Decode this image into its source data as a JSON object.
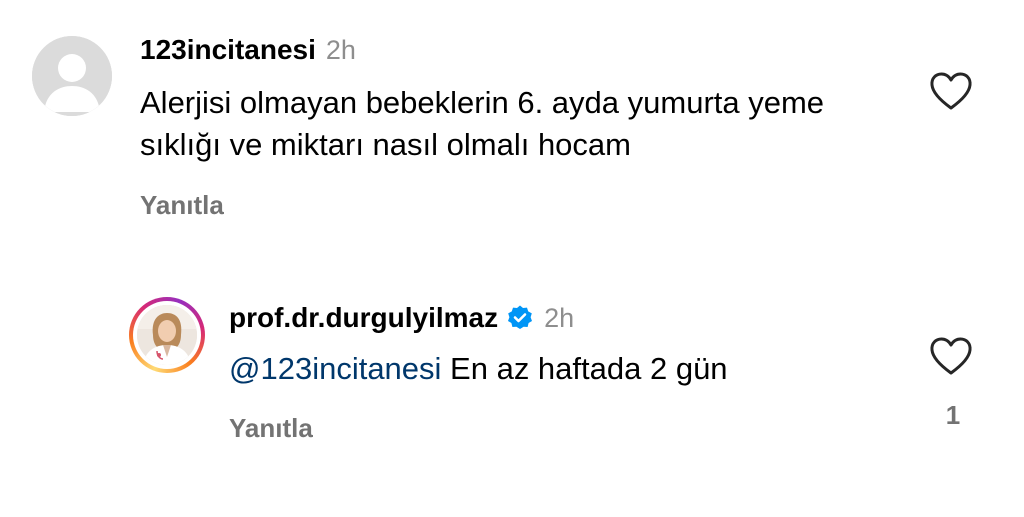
{
  "comments": [
    {
      "username": "123incitanesi",
      "time": "2h",
      "text": "Alerjisi olmayan bebeklerin 6. ayda yumurta yeme sıklığı ve miktarı nasıl olmalı hocam",
      "reply_label": "Yanıtla",
      "avatar": "default-user-avatar",
      "like_icon": "heart-outline-icon"
    },
    {
      "username": "prof.dr.durgulyilmaz",
      "verified": true,
      "verified_icon": "verified-badge-icon",
      "time": "2h",
      "mention": "@123incitanesi",
      "text": " En az haftada 2 gün",
      "reply_label": "Yanıtla",
      "avatar": "profile-photo-story-ring",
      "like_icon": "heart-outline-icon",
      "like_count": "1"
    }
  ],
  "colors": {
    "username": "#000000",
    "secondary_text": "#8e8e8e",
    "reply_link": "#737373",
    "mention_link": "#00376b",
    "verified_badge": "#0095f6"
  }
}
